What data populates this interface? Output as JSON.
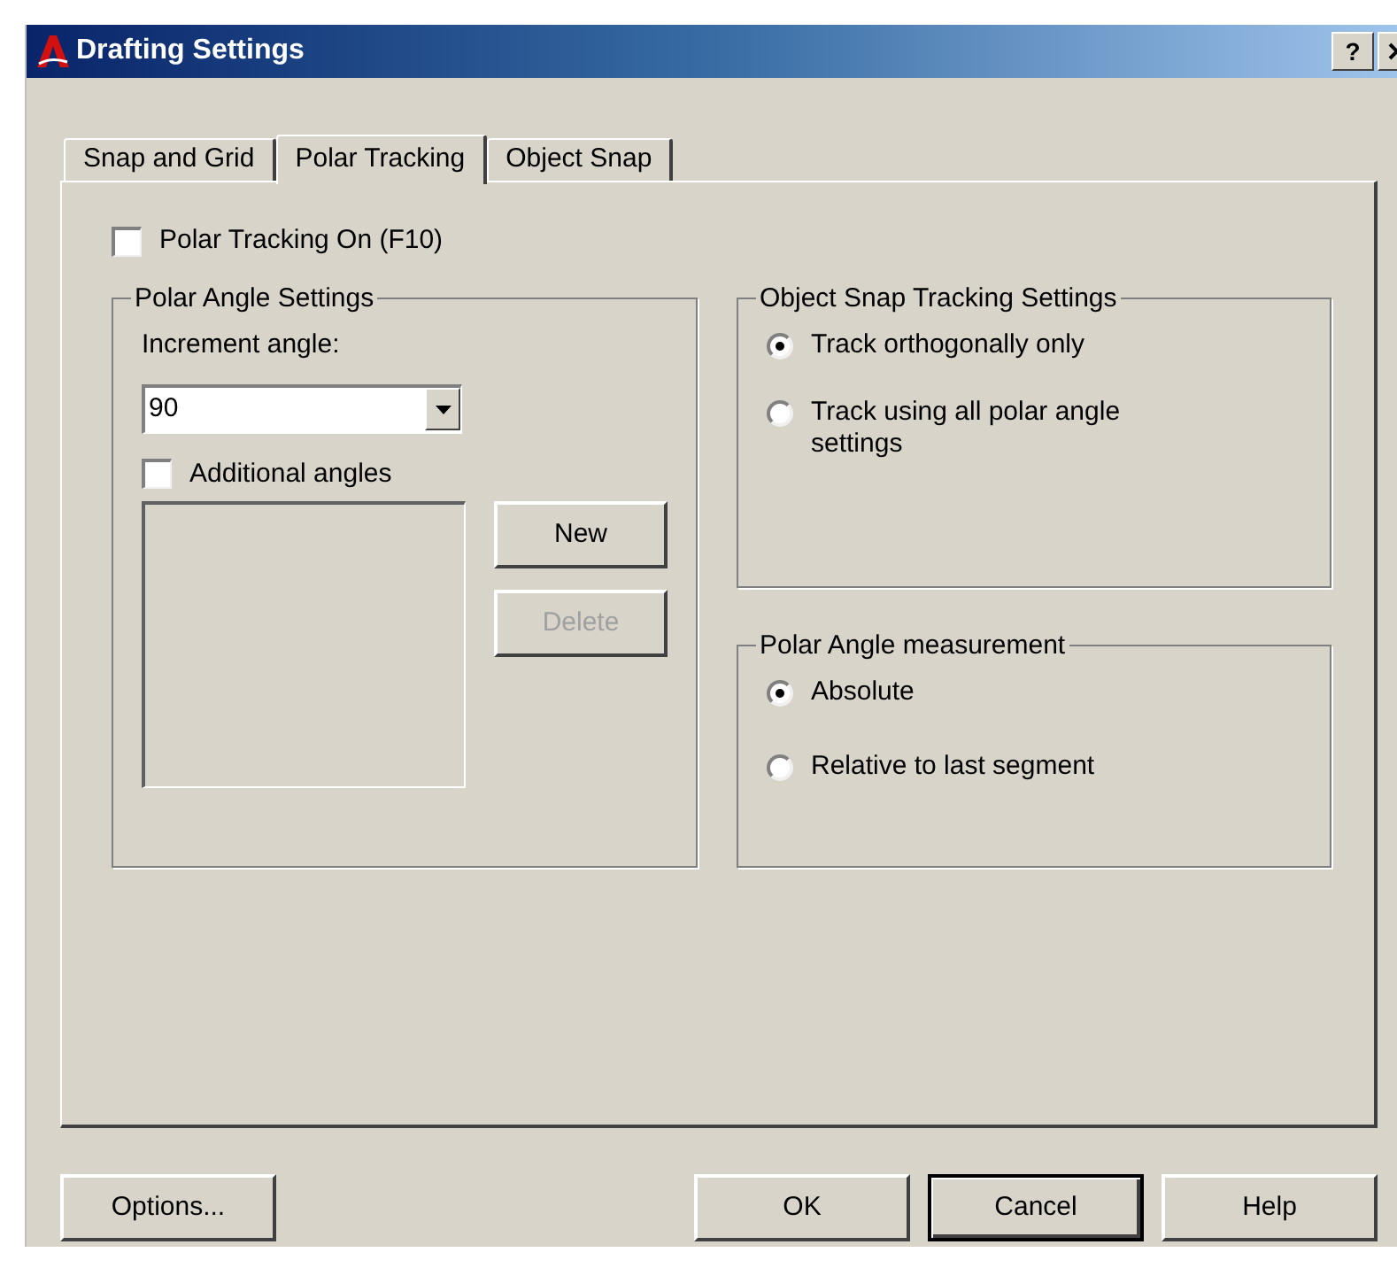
{
  "window": {
    "title": "Drafting Settings",
    "help_button": "?"
  },
  "tabs": [
    {
      "label": "Snap and Grid",
      "selected": false
    },
    {
      "label": "Polar Tracking",
      "selected": true
    },
    {
      "label": "Object Snap",
      "selected": false
    }
  ],
  "polar_tracking_on": {
    "label": "Polar Tracking On (F10)",
    "checked": false
  },
  "polar_angle_settings": {
    "title": "Polar Angle Settings",
    "increment_label": "Increment angle:",
    "increment_value": "90",
    "additional_angles": {
      "label": "Additional angles",
      "checked": false
    },
    "buttons": [
      {
        "label": "New",
        "disabled": false
      },
      {
        "label": "Delete",
        "disabled": true
      }
    ]
  },
  "object_snap_tracking": {
    "title": "Object Snap Tracking Settings",
    "options": [
      {
        "label": "Track orthogonally only",
        "selected": true
      },
      {
        "label": "Track using all polar angle settings",
        "selected": false
      }
    ]
  },
  "polar_angle_measurement": {
    "title": "Polar Angle measurement",
    "options": [
      {
        "label": "Absolute",
        "selected": true
      },
      {
        "label": "Relative to last segment",
        "selected": false
      }
    ]
  },
  "footer_buttons": [
    {
      "label": "Options...",
      "default": false
    },
    {
      "label": "OK",
      "default": false
    },
    {
      "label": "Cancel",
      "default": true
    },
    {
      "label": "Help",
      "default": false
    }
  ]
}
